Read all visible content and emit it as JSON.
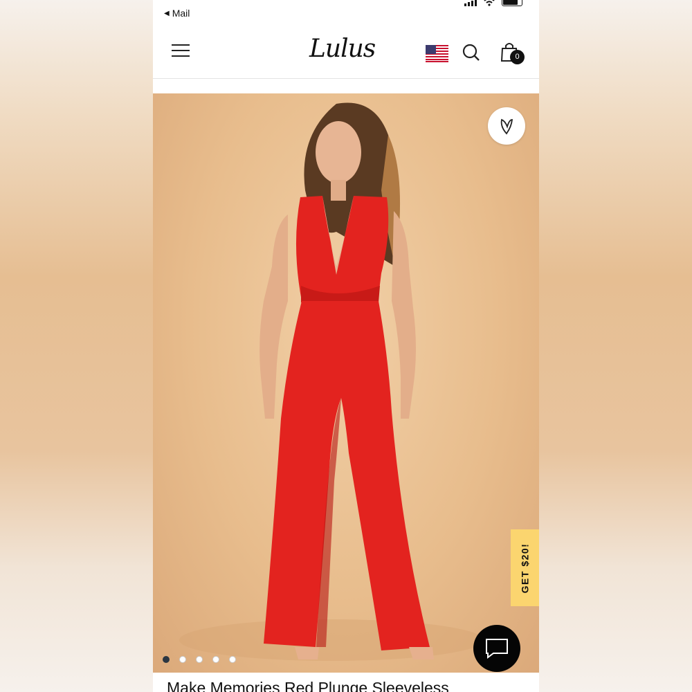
{
  "status_bar": {
    "back_label": "Mail"
  },
  "header": {
    "logo": "Lulus",
    "cart_count": "0"
  },
  "product": {
    "title": "Make Memories Red Plunge Sleeveless",
    "image_count": 5,
    "active_image": 1
  },
  "promo": {
    "label": "GET $20!"
  },
  "colors": {
    "promo_bg": "#fbd56f",
    "chat_bg": "#050505",
    "jumpsuit_red": "#e3231f",
    "backdrop": "#e8bd8d"
  },
  "icons": [
    "menu-icon",
    "flag-icon",
    "search-icon",
    "bag-icon",
    "heart-icon",
    "chat-icon"
  ]
}
